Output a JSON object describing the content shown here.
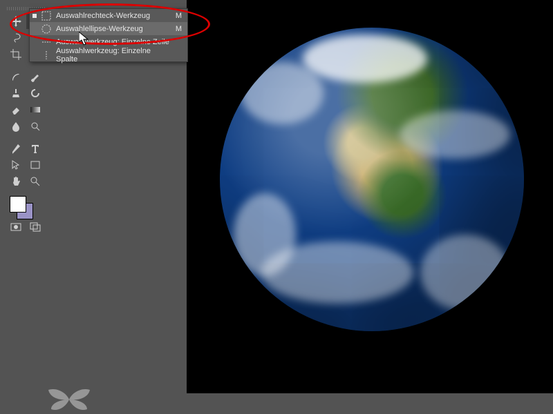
{
  "flyout": {
    "items": [
      {
        "label": "Auswahlrechteck-Werkzeug",
        "shortcut": "M",
        "current": true
      },
      {
        "label": "Auswahlellipse-Werkzeug",
        "shortcut": "M",
        "current": false
      },
      {
        "label": "Auswahlwerkzeug: Einzelne Zeile",
        "shortcut": "",
        "current": false
      },
      {
        "label": "Auswahlwerkzeug: Einzelne Spalte",
        "shortcut": "",
        "current": false
      }
    ],
    "highlighted_index": 1
  },
  "toolbox": {
    "swatch_fg": "#ffffff",
    "swatch_bg": "#9a93c6"
  },
  "annotation": {
    "color": "#dc0000"
  },
  "canvas": {
    "subject": "earth-globe"
  }
}
